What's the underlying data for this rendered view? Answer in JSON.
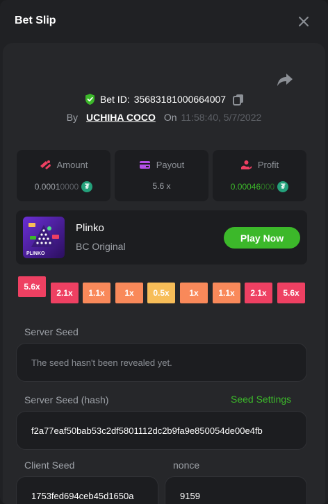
{
  "header": {
    "title": "Bet Slip"
  },
  "bet": {
    "id_label": "Bet ID:",
    "id": "35683181000664007",
    "by_label": "By",
    "user": "UCHIHA COCO",
    "on_label": "On",
    "time": "11:58:40, 5/7/2022"
  },
  "stats": {
    "amount": {
      "label": "Amount",
      "value_main": "0.0001",
      "value_faded": "0000"
    },
    "payout": {
      "label": "Payout",
      "value": "5.6 x"
    },
    "profit": {
      "label": "Profit",
      "value_main": "0.00046",
      "value_faded": "000"
    }
  },
  "game": {
    "name": "Plinko",
    "category": "BC Original",
    "thumb_text": "PLINKO",
    "play_label": "Play Now"
  },
  "multipliers": {
    "active": "5.6x",
    "row": [
      "2.1x",
      "1.1x",
      "1x",
      "0.5x",
      "1x",
      "1.1x",
      "2.1x",
      "5.6x"
    ]
  },
  "seeds": {
    "server_seed_label": "Server Seed",
    "server_seed_value": "The seed hasn't been revealed yet.",
    "server_hash_label": "Server Seed (hash)",
    "seed_settings_label": "Seed Settings",
    "server_hash_value": "f2a77eaf50bab53c2df5801112dc2b9fa9e850054de00e4fb",
    "client_seed_label": "Client Seed",
    "client_seed_value": "1753fed694ceb45d1650a",
    "nonce_label": "nonce",
    "nonce_value": "9159"
  },
  "colors": {
    "accent_green": "#3cb82a",
    "coin_green": "#24a17b",
    "mult_red": "#ee4062",
    "mult_orange": "#f9895a",
    "mult_yellow": "#f7bd58"
  }
}
